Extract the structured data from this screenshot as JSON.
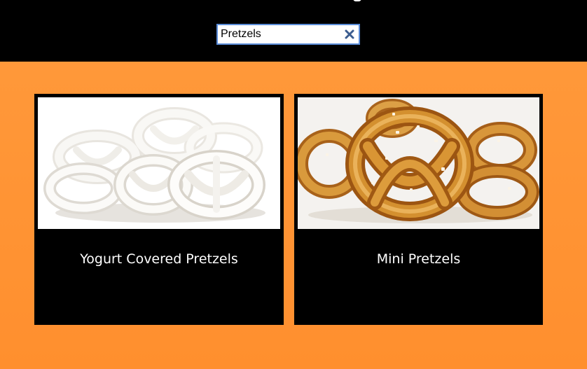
{
  "search": {
    "value": "Pretzels"
  },
  "icons": {
    "clear": "close-icon"
  },
  "colors": {
    "background": "#ff9535",
    "header": "#000000",
    "card": "#000000",
    "search_border": "#5b8dd9",
    "clear_icon": "#3b5c8f"
  },
  "results": [
    {
      "label": "Yogurt Covered Pretzels"
    },
    {
      "label": "Mini Pretzels"
    }
  ]
}
